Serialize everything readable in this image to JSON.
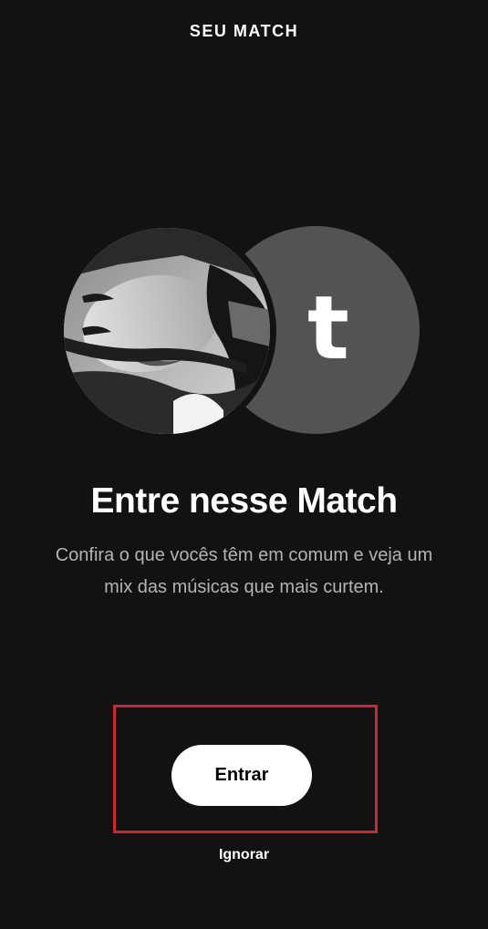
{
  "header": {
    "title": "SEU MATCH"
  },
  "avatars": {
    "user_photo": "user-profile-photo",
    "other_initial": "t",
    "other_bg_color": "#535353"
  },
  "main": {
    "title": "Entre nesse Match",
    "description": "Confira o que vocês têm em comum e veja um mix das músicas que mais curtem."
  },
  "actions": {
    "enter_label": "Entrar",
    "ignore_label": "Ignorar",
    "highlight_color": "#d1262f"
  },
  "colors": {
    "background": "#121212",
    "text_primary": "#ffffff",
    "text_secondary": "#b3b3b3"
  }
}
